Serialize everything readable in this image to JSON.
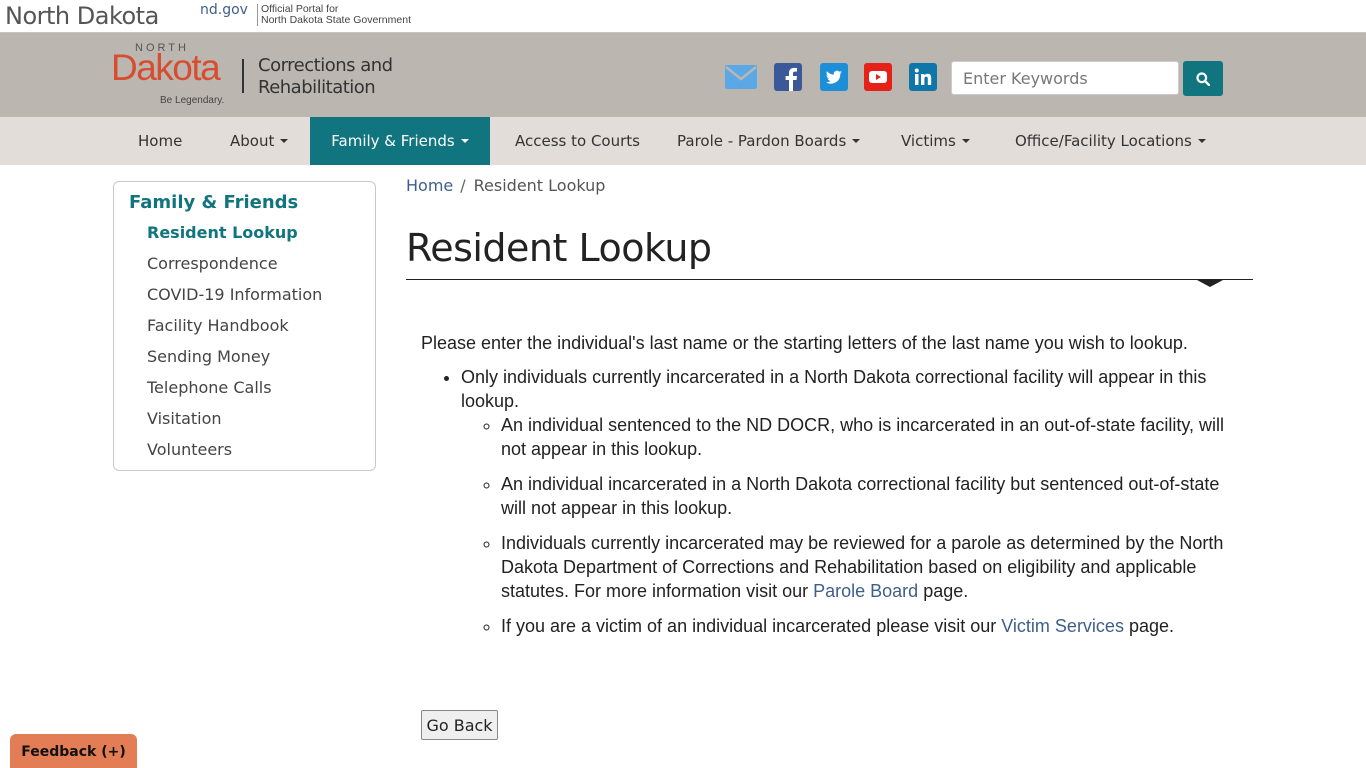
{
  "topbar": {
    "state_name": "North Dakota",
    "ndgov": "nd.gov",
    "portal_line1": "Official Portal for",
    "portal_line2": "North Dakota State Government"
  },
  "logo": {
    "north": "NORTH",
    "dakota": "Dakota",
    "tagline": "Be Legendary.",
    "dept_line1": "Corrections and",
    "dept_line2": "Rehabilitation"
  },
  "social": [
    {
      "icon": "mail-icon",
      "color": "#5aa9e6"
    },
    {
      "icon": "facebook-icon",
      "color": "#3b5998"
    },
    {
      "icon": "twitter-icon",
      "color": "#1d8fd8"
    },
    {
      "icon": "youtube-icon",
      "color": "#e62117"
    },
    {
      "icon": "linkedin-icon",
      "color": "#0e76a8"
    }
  ],
  "search": {
    "placeholder": "Enter Keywords",
    "value": ""
  },
  "nav": {
    "items": [
      {
        "label": "Home",
        "dropdown": false,
        "active": false
      },
      {
        "label": "About",
        "dropdown": true,
        "active": false
      },
      {
        "label": "Family & Friends",
        "dropdown": true,
        "active": true
      },
      {
        "label": "Access to Courts",
        "dropdown": false,
        "active": false
      },
      {
        "label": "Parole - Pardon Boards",
        "dropdown": true,
        "active": false
      },
      {
        "label": "Victims",
        "dropdown": true,
        "active": false
      },
      {
        "label": "Office/Facility Locations",
        "dropdown": true,
        "active": false
      }
    ]
  },
  "sidebar": {
    "title": "Family & Friends",
    "items": [
      {
        "label": "Resident Lookup",
        "active": true
      },
      {
        "label": "Correspondence",
        "active": false
      },
      {
        "label": "COVID-19 Information",
        "active": false
      },
      {
        "label": "Facility Handbook",
        "active": false
      },
      {
        "label": "Sending Money",
        "active": false
      },
      {
        "label": "Telephone Calls",
        "active": false
      },
      {
        "label": "Visitation",
        "active": false
      },
      {
        "label": "Volunteers",
        "active": false
      }
    ]
  },
  "breadcrumb": {
    "home": "Home",
    "separator": "/",
    "current": "Resident Lookup"
  },
  "page": {
    "title": "Resident Lookup",
    "intro": "Please enter the individual's last name or the starting letters of the last name you wish to lookup.",
    "bullet1": "Only individuals currently incarcerated in a North Dakota correctional facility will appear in this lookup.",
    "sub1": "An individual sentenced to the ND DOCR, who is incarcerated in an out-of-state facility, will not appear in this lookup.",
    "sub2": "An individual incarcerated in a North Dakota correctional facility but sentenced out-of-state will not appear in this lookup.",
    "sub3_pre": "Individuals currently incarcerated may be reviewed for a parole as determined by the North Dakota Department of Corrections and Rehabilitation based on eligibility and applicable statutes. For more information visit our ",
    "sub3_link": "Parole Board",
    "sub3_post": " page.",
    "sub4_pre": "If you are a victim of an individual incarcerated please visit our ",
    "sub4_link": "Victim Services",
    "sub4_post": " page.",
    "go_back": "Go Back"
  },
  "feedback": {
    "label": "Feedback (+)",
    "color": "#e27d55"
  },
  "colors": {
    "teal": "#10757e",
    "header_bg": "#bcb6b1",
    "nav_bg": "#e2ddd9",
    "link": "#3f5e8c",
    "logo_red": "#d64d30"
  }
}
